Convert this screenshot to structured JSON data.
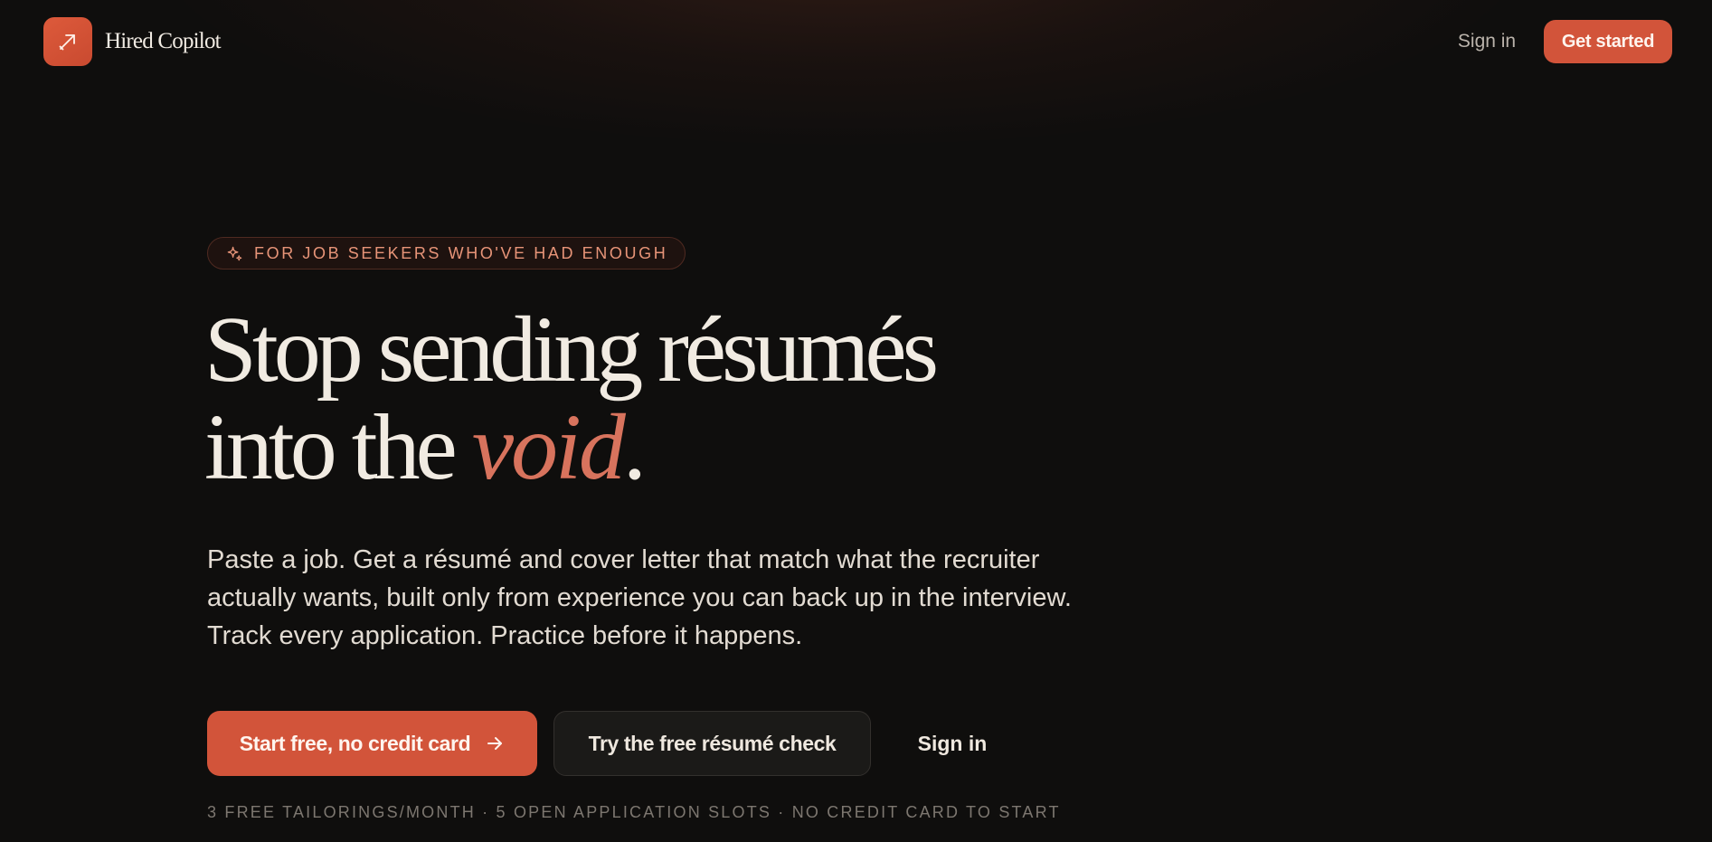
{
  "brand": {
    "name": "Hired Copilot",
    "logo_icon": "arrow-up-right-icon",
    "accent_color": "#d2543a"
  },
  "nav": {
    "sign_in": "Sign in",
    "get_started": "Get started"
  },
  "hero": {
    "eyebrow_icon": "sparkle-icon",
    "eyebrow": "FOR JOB SEEKERS WHO'VE HAD ENOUGH",
    "headline_line1": "Stop sending résumés",
    "headline_line2_prefix": "into the ",
    "headline_accent": "void",
    "headline_suffix": ".",
    "description": "Paste a job. Get a résumé and cover letter that match what the recruiter actually wants, built only from experience you can back up in the interview. Track every application. Practice before it happens.",
    "cta_primary": "Start free, no credit card",
    "cta_primary_icon": "arrow-right-icon",
    "cta_secondary": "Try the free résumé check",
    "cta_signin": "Sign in",
    "footnote": "3 FREE TAILORINGS/MONTH · 5 OPEN APPLICATION SLOTS · NO CREDIT CARD TO START"
  }
}
